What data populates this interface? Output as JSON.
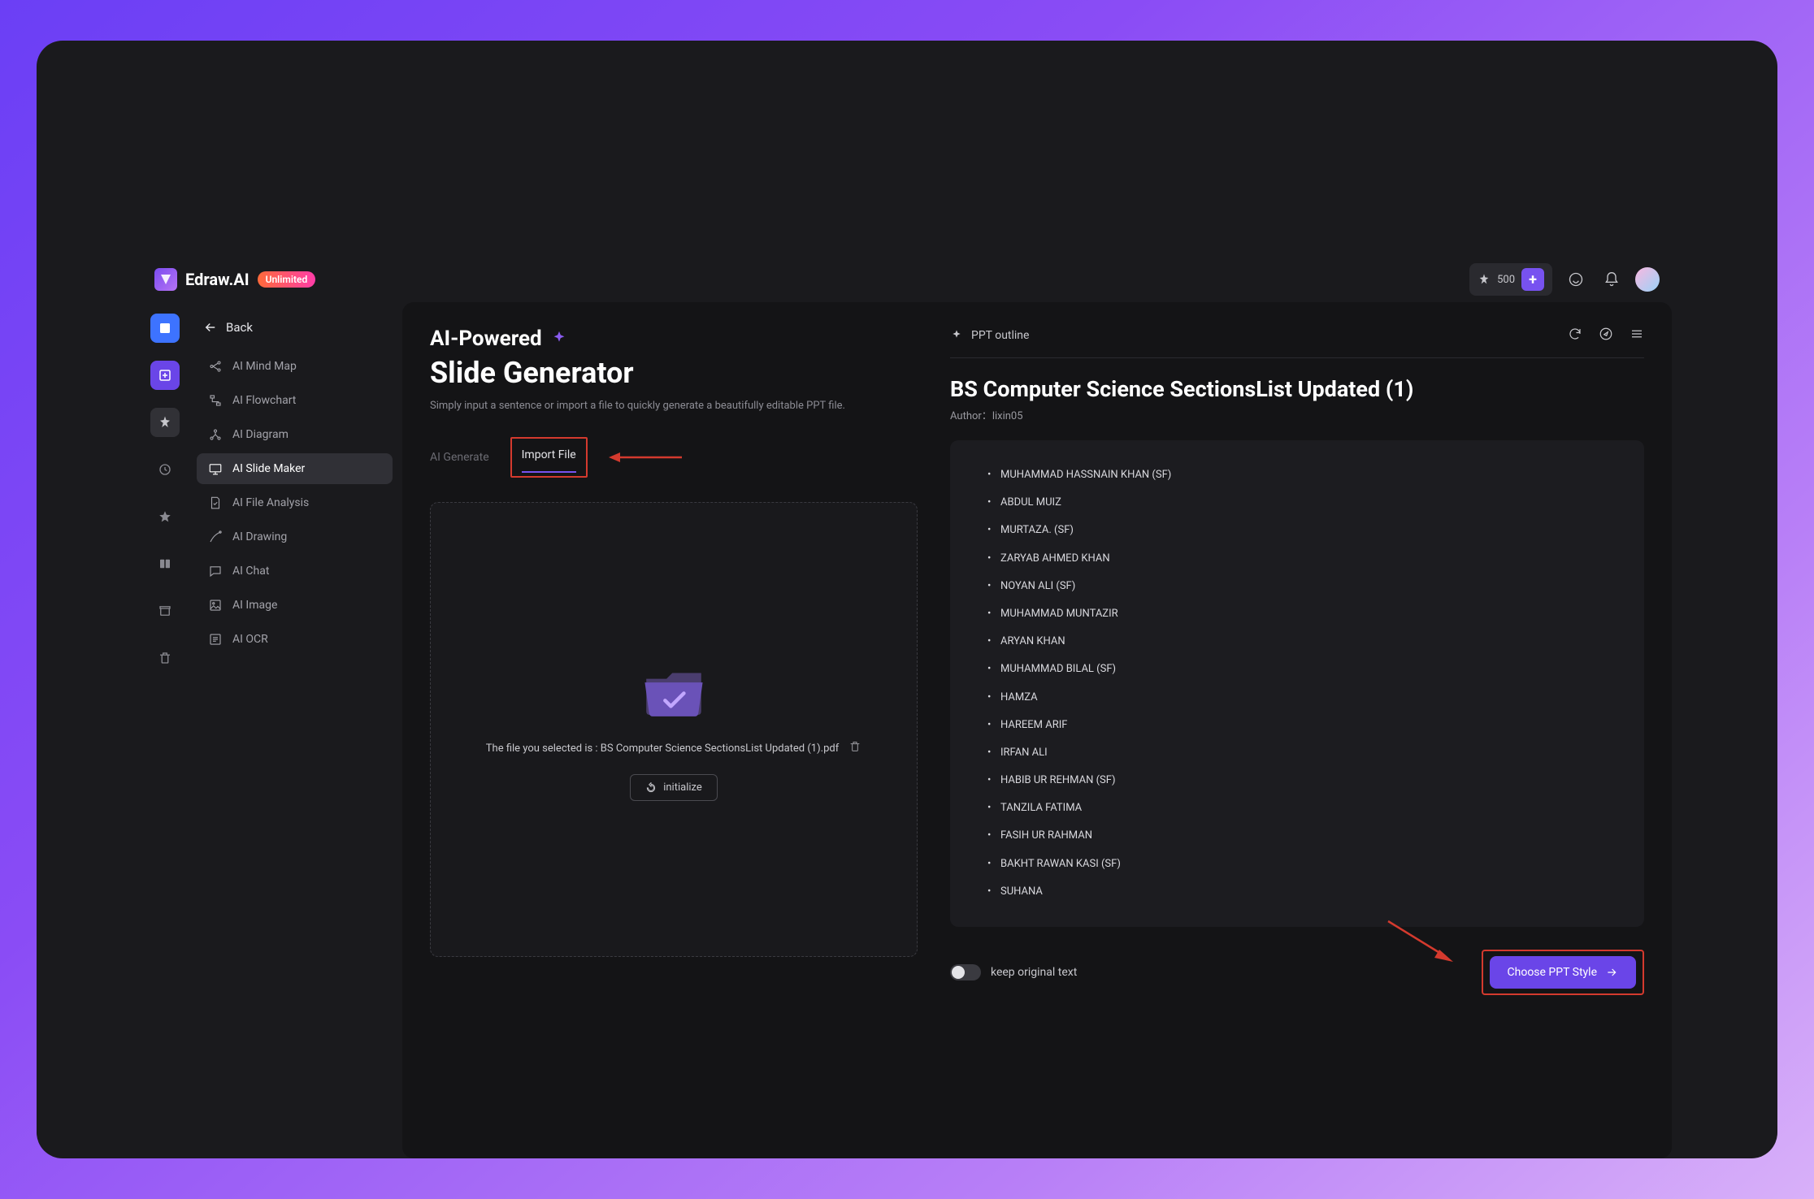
{
  "brand": {
    "name": "Edraw.AI",
    "badge": "Unlimited"
  },
  "topbar": {
    "credits": "500"
  },
  "sidebar": {
    "back": "Back",
    "items": [
      {
        "label": "AI Mind Map"
      },
      {
        "label": "AI Flowchart"
      },
      {
        "label": "AI Diagram"
      },
      {
        "label": "AI Slide Maker"
      },
      {
        "label": "AI File Analysis"
      },
      {
        "label": "AI Drawing"
      },
      {
        "label": "AI Chat"
      },
      {
        "label": "AI Image"
      },
      {
        "label": "AI OCR"
      }
    ]
  },
  "main": {
    "ai_powered": "AI-Powered",
    "title": "Slide Generator",
    "subtitle": "Simply input a sentence or import a file to quickly generate a beautifully editable PPT file.",
    "tabs": {
      "generate": "AI Generate",
      "import": "Import File"
    },
    "file_label": "The file you selected is : BS Computer Science SectionsList Updated (1).pdf",
    "initialize": "initialize"
  },
  "outline": {
    "header": "PPT outline",
    "title": "BS Computer Science SectionsList Updated (1)",
    "author_label": "Author：",
    "author": "lixin05",
    "items": [
      "MUHAMMAD HASSNAIN KHAN (SF)",
      "ABDUL MUIZ",
      "MURTAZA. (SF)",
      "ZARYAB AHMED KHAN",
      "NOYAN ALI (SF)",
      "MUHAMMAD MUNTAZIR",
      "ARYAN KHAN",
      "MUHAMMAD BILAL (SF)",
      "HAMZA",
      "HAREEM ARIF",
      "IRFAN ALI",
      "HABIB UR REHMAN (SF)",
      "TANZILA FATIMA",
      "FASIH UR RAHMAN",
      "BAKHT RAWAN KASI (SF)",
      "SUHANA"
    ]
  },
  "footer": {
    "toggle_label": "keep original text",
    "cta": "Choose PPT Style"
  }
}
